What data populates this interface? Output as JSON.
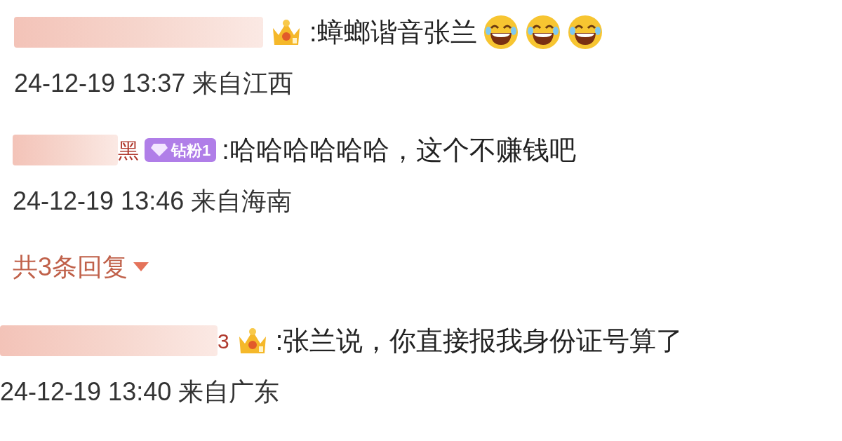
{
  "comments": [
    {
      "badge": {
        "kind": "crown"
      },
      "text": ":蟑螂谐音张兰",
      "emojis": [
        {
          "kind": "laugh"
        },
        {
          "kind": "laugh"
        },
        {
          "kind": "laugh"
        }
      ],
      "meta": "24-12-19 13:37 来自江西"
    },
    {
      "name_fragment": "黑",
      "badge": {
        "kind": "fan",
        "label": "钻粉1"
      },
      "text": ":哈哈哈哈哈哈，这个不赚钱吧",
      "meta": "24-12-19 13:46 来自海南",
      "replies": "共3条回复"
    },
    {
      "name_fragment": "3",
      "badge": {
        "kind": "crown"
      },
      "text": ":张兰说，你直接报我身份证号算了",
      "meta": "24-12-19 13:40 来自广东"
    }
  ]
}
